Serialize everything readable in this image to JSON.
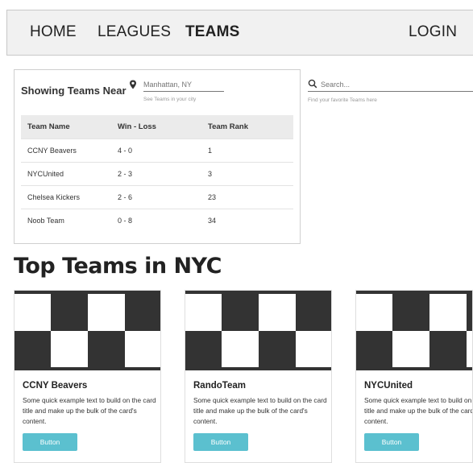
{
  "nav": {
    "home": "HOME",
    "leagues": "LEAGUES",
    "teams": "TEAMS",
    "login": "LOGIN"
  },
  "near": {
    "title": "Showing Teams Near",
    "location_placeholder": "Manhattan, NY",
    "help": "See Teams in your city",
    "icon": "location-pin-icon"
  },
  "table": {
    "headers": [
      "Team Name",
      "Win - Loss",
      "Team Rank"
    ],
    "rows": [
      [
        "CCNY Beavers",
        "4 - 0",
        "1"
      ],
      [
        "NYCUnited",
        "2 - 3",
        "3"
      ],
      [
        "Chelsea Kickers",
        "2 - 6",
        "23"
      ],
      [
        "Noob Team",
        "0 - 8",
        "34"
      ]
    ]
  },
  "search": {
    "placeholder": "Search...",
    "help": "Find your favorite Teams here",
    "icon": "search-icon"
  },
  "top": {
    "title": "Top Teams in NYC",
    "cards": [
      {
        "title": "CCNY Beavers",
        "text": "Some quick example text to build on the card title and make up the bulk of the card's content.",
        "button": "Button"
      },
      {
        "title": "RandoTeam",
        "text": "Some quick example text to build on the card title and make up the bulk of the card's content.",
        "button": "Button"
      },
      {
        "title": "NYCUnited",
        "text": "Some quick example text to build on the card title and make up the bulk of the card's content.",
        "button": "Button"
      }
    ]
  },
  "colors": {
    "button": "#5bc0cf",
    "checker_dark": "#333333",
    "nav_bg": "#f1f1f1"
  }
}
